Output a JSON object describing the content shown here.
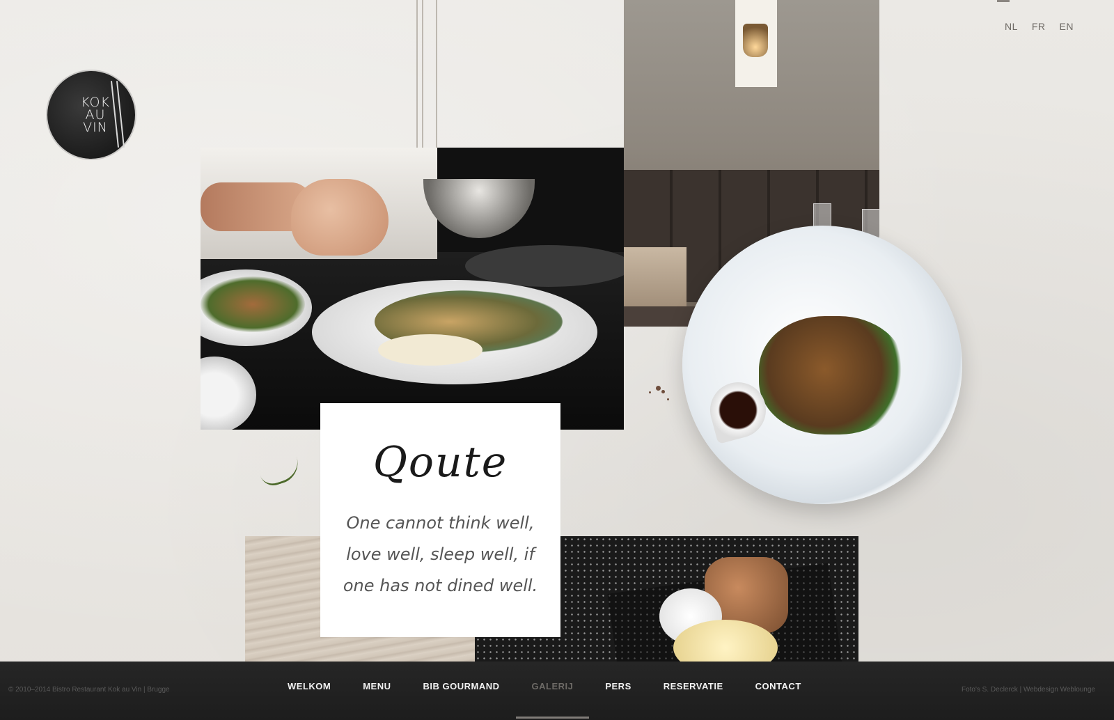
{
  "logo": {
    "line1": "KOK",
    "line2": "AU",
    "line3": "VIN"
  },
  "languages": [
    "NL",
    "FR",
    "EN"
  ],
  "quote": {
    "title": "Qoute",
    "text": "One cannot think well, love well, sleep well, if one has not dined well."
  },
  "nav": {
    "items": [
      {
        "label": "WELKOM"
      },
      {
        "label": "MENU"
      },
      {
        "label": "BIB GOURMAND"
      },
      {
        "label": "GALERIJ",
        "active": true
      },
      {
        "label": "PERS"
      },
      {
        "label": "RESERVATIE"
      },
      {
        "label": "CONTACT"
      }
    ]
  },
  "footer": {
    "copyright": "© 2010–2014 Bistro Restaurant Kok au Vin | Brugge",
    "credits": "Foto's S. Declerck | Webdesign Weblounge"
  },
  "colors": {
    "background": "#e9e7e3",
    "footer": "#222222",
    "nav_text": "#f2f2f2",
    "nav_active": "#6d6a66"
  }
}
